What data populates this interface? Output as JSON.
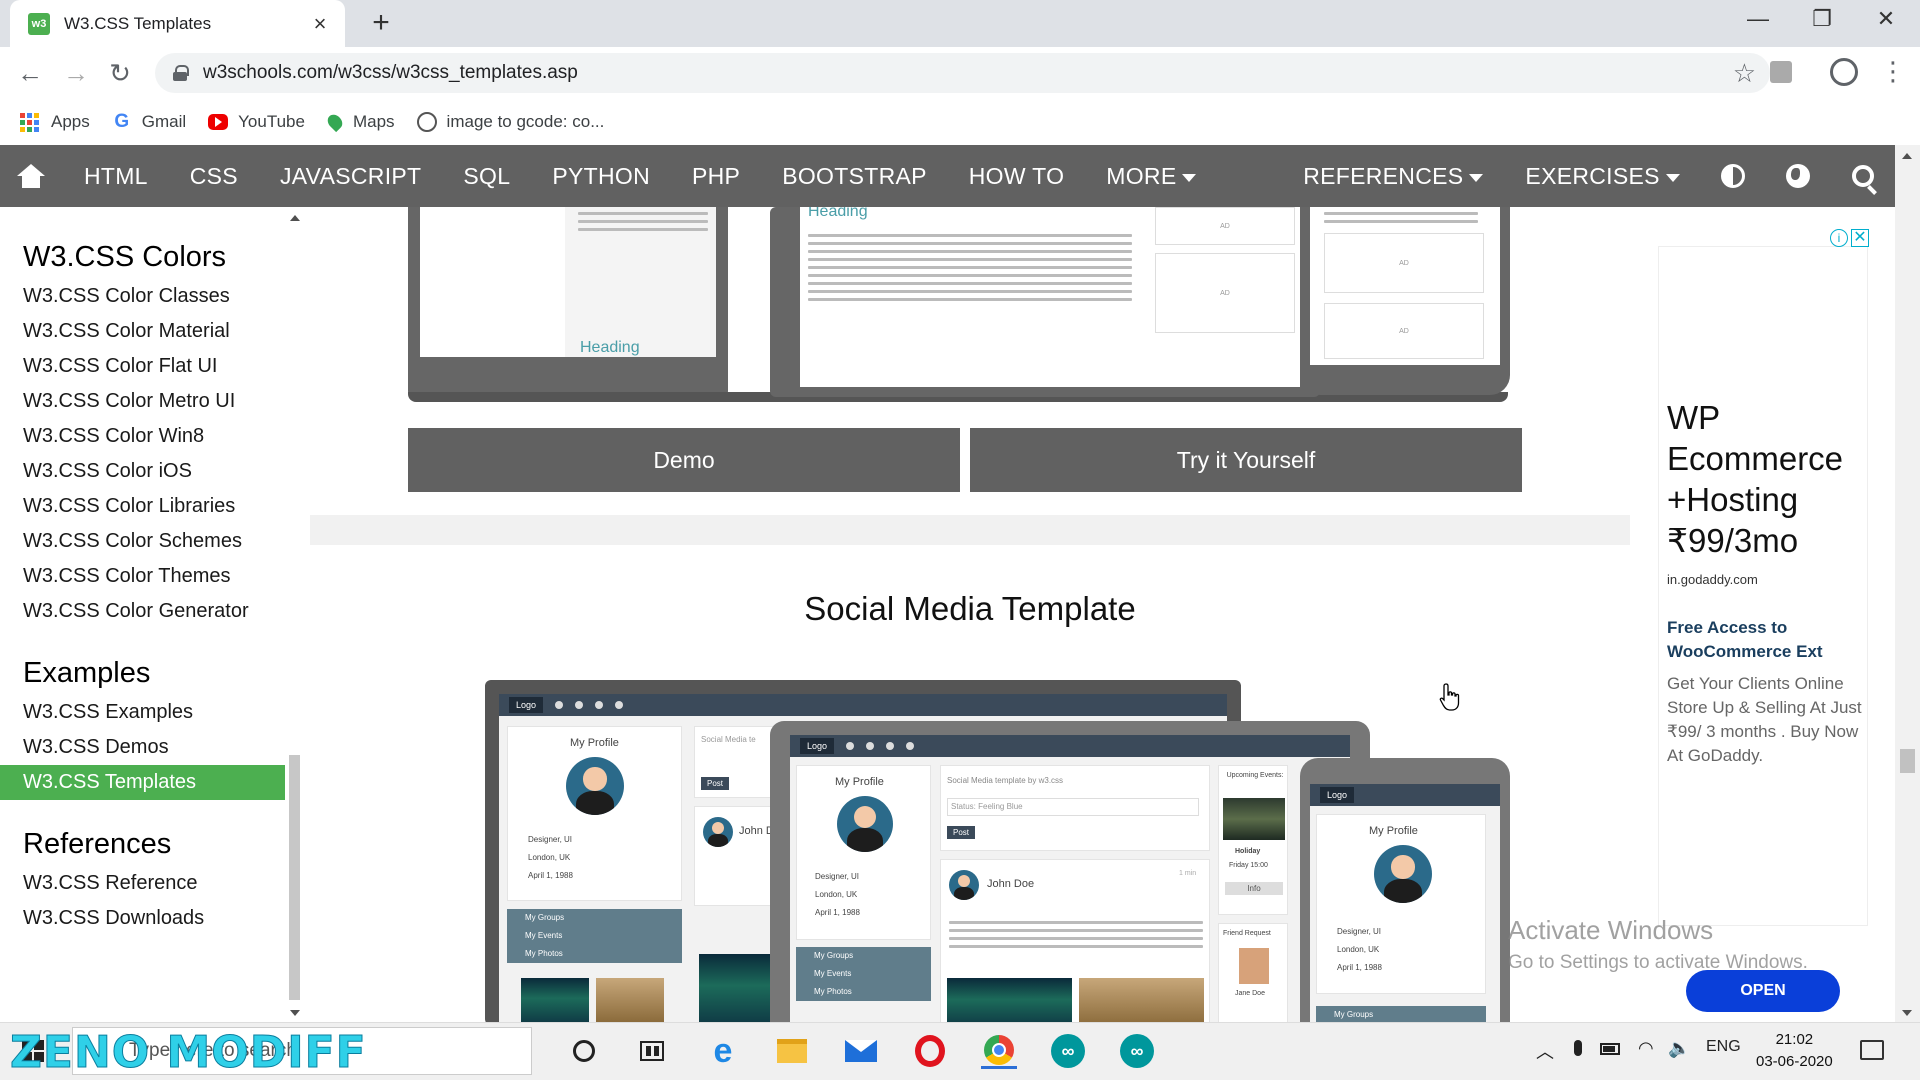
{
  "browser": {
    "tab_title": "W3.CSS Templates",
    "favicon_text": "w3",
    "new_tab": "+",
    "url": "w3schools.com/w3css/w3css_templates.asp",
    "window_controls": [
      "—",
      "❐",
      "✕"
    ]
  },
  "bookmarks": [
    {
      "label": "Apps",
      "icon": "apps-grid-icon"
    },
    {
      "label": "Gmail",
      "icon": "google-icon"
    },
    {
      "label": "YouTube",
      "icon": "youtube-icon"
    },
    {
      "label": "Maps",
      "icon": "maps-pin-icon"
    },
    {
      "label": "image to gcode: co...",
      "icon": "globe-icon"
    }
  ],
  "navbar": {
    "items": [
      "HTML",
      "CSS",
      "JAVASCRIPT",
      "SQL",
      "PYTHON",
      "PHP",
      "BOOTSTRAP",
      "HOW TO"
    ],
    "more": "MORE",
    "references": "REFERENCES",
    "exercises": "EXERCISES"
  },
  "sidebar": {
    "sections": [
      {
        "heading": "W3.CSS Colors",
        "links": [
          "W3.CSS Color Classes",
          "W3.CSS Color Material",
          "W3.CSS Color Flat UI",
          "W3.CSS Color Metro UI",
          "W3.CSS Color Win8",
          "W3.CSS Color iOS",
          "W3.CSS Color Libraries",
          "W3.CSS Color Schemes",
          "W3.CSS Color Themes",
          "W3.CSS Color Generator"
        ]
      },
      {
        "heading": "Examples",
        "links": [
          "W3.CSS Examples",
          "W3.CSS Demos",
          "W3.CSS Templates"
        ]
      },
      {
        "heading": "References",
        "links": [
          "W3.CSS Reference",
          "W3.CSS Downloads"
        ]
      }
    ],
    "active_link": "W3.CSS Templates"
  },
  "main": {
    "demo_button": "Demo",
    "try_button": "Try it Yourself",
    "mockup_heading": "Heading",
    "ad_label": "AD",
    "section_title": "Social Media Template",
    "mockup": {
      "logo": "Logo",
      "my_profile": "My Profile",
      "designer": "Designer, UI",
      "location": "London, UK",
      "birthday": "April 1, 1988",
      "status_title": "Social Media template by w3.css",
      "status_field": "Status: Feeling Blue",
      "post_button": "Post",
      "user_name": "John Doe",
      "time": "1 min",
      "upcoming": "Upcoming Events:",
      "holiday": "Holiday",
      "event_time": "Friday 15:00",
      "info_button": "Info",
      "friend_request": "Friend Request",
      "friend_name": "Jane Doe",
      "menu": [
        "My Groups",
        "My Events",
        "My Photos"
      ]
    }
  },
  "ad": {
    "headline": "WP Ecommerce +Hosting ₹99/3mo",
    "domain": "in.godaddy.com",
    "subhead": "Free Access to WooCommerce Ext",
    "body": "Get Your Clients Online Store Up & Selling At Just ₹99/ 3 months . Buy Now At GoDaddy.",
    "cta": "OPEN",
    "info": "i",
    "close": "✕"
  },
  "watermark": {
    "line1": "Activate Windows",
    "line2": "Go to Settings to activate Windows."
  },
  "taskbar": {
    "search_placeholder": "Type here to search",
    "overlay_text": "ZENO MODIFF",
    "language": "ENG",
    "time": "21:02",
    "date": "03-06-2020"
  },
  "colors": {
    "nav_bg": "#616161",
    "active_green": "#4caf50",
    "ad_cta": "#0a3fd9"
  }
}
